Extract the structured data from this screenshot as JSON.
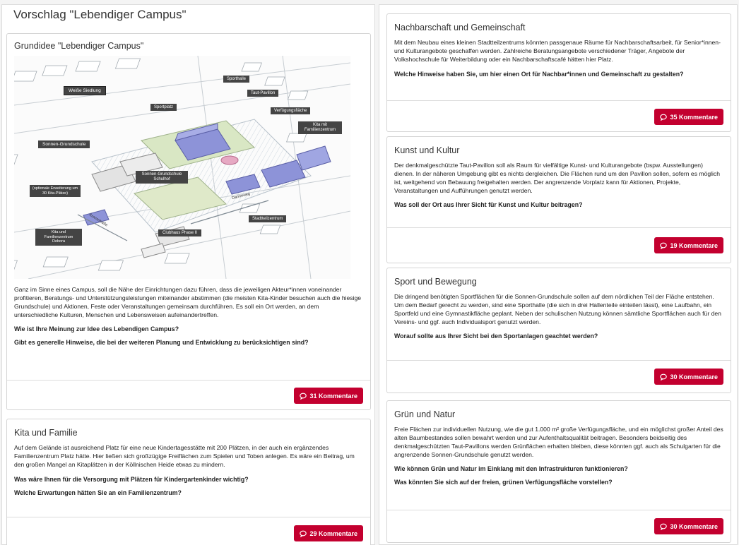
{
  "page": {
    "title": "Vorschlag \"Lebendiger Campus\""
  },
  "cards": [
    {
      "title": "Grundidee \"Lebendiger Campus\"",
      "text": "Ganz im Sinne eines Campus, soll die Nähe der Einrichtungen dazu führen, dass die jeweiligen Akteur*innen voneinander profitieren, Beratungs- und Unterstützungsleistungen miteinander abstimmen (die meisten Kita-Kinder besuchen auch die hiesige Grundschule) und Aktionen, Feste oder Veranstaltungen gemeinsam durchführen. Es soll ein Ort werden, an dem unterschiedliche Kulturen, Menschen und Lebensweisen aufeinandertreffen.",
      "questions": [
        "Wie ist Ihre Meinung zur Idee des Lebendigen Campus?",
        "Gibt es generelle Hinweise, die bei der weiteren Planung und Entwicklung zu berücksichtigen sind?"
      ],
      "button": "31 Kommentare"
    },
    {
      "title": "Kita und Familie",
      "text": "Auf dem Gelände ist ausreichend Platz für eine neue Kindertagesstätte mit 200 Plätzen, in der auch ein ergänzendes Familienzentrum Platz hätte. Hier ließen sich großzügige Freiflächen zum Spielen und Toben anlegen. Es wäre ein Beitrag, um den großen Mangel an Kitaplätzen in der Köllnischen Heide etwas zu mindern.",
      "questions": [
        "Was wäre Ihnen für die Versorgung mit Plätzen für Kindergartenkinder wichtig?",
        "Welche Erwartungen hätten Sie an ein Familienzentrum?"
      ],
      "button": "29 Kommentare"
    },
    {
      "title": "Nachbarschaft und Gemeinschaft",
      "text": "Mit dem Neubau eines kleinen Stadtteilzentrums könnten passgenaue Räume für Nachbarschaftsarbeit, für Senior*innen- und Kulturangebote geschaffen werden. Zahlreiche Beratungsangebote verschiedener Träger, Angebote der Volkshochschule für Weiterbildung oder ein Nachbarschaftscafé hätten hier Platz.",
      "questions": [
        "Welche Hinweise haben Sie, um hier einen Ort für Nachbar*innen und Gemeinschaft zu gestalten?"
      ],
      "button": "35 Kommentare"
    },
    {
      "title": "Kunst und Kultur",
      "text": "Der denkmalgeschützte Taut-Pavillon soll als Raum für vielfältige Kunst- und Kulturangebote (bspw. Ausstellungen) dienen. In der näheren Umgebung gibt es nichts dergleichen. Die Flächen rund um den Pavillon sollen, sofern es möglich ist, weitgehend von Bebauung freigehalten werden. Der angrenzende Vorplatz kann für Aktionen, Projekte, Veranstaltungen und Aufführungen genutzt werden.",
      "questions": [
        "Was soll der Ort aus Ihrer Sicht für Kunst und Kultur beitragen?"
      ],
      "button": "19 Kommentare"
    },
    {
      "title": "Sport und Bewegung",
      "text": "Die dringend benötigten Sportflächen für die Sonnen-Grundschule sollen auf dem nördlichen Teil der Fläche entstehen. Um dem Bedarf gerecht zu werden, sind eine Sporthalle (die sich in drei Hallenteile einteilen lässt), eine Laufbahn, ein Sportfeld und eine Gymnastikfläche geplant. Neben der schulischen Nutzung können sämtliche Sportflächen auch für den Vereins- und ggf. auch Individualsport genutzt werden.",
      "questions": [
        "Worauf sollte aus Ihrer Sicht bei den Sportanlagen geachtet werden?"
      ],
      "button": "30 Kommentare"
    },
    {
      "title": "Grün und Natur",
      "text": "Freie Flächen zur individuellen Nutzung, wie die gut 1.000 m² große Verfügungsfläche, und ein möglichst großer Anteil des alten Baumbestandes sollen bewahrt werden und zur Aufenthaltsqualität beitragen. Besonders beidseitig des denkmalgeschützten Taut-Pavillons werden Grünflächen erhalten bleiben, diese könnten ggf. auch als Schulgarten für die angrenzende Sonnen-Grundschule genutzt werden.",
      "questions": [
        "Wie können Grün und Natur im Einklang mit den Infrastrukturen funktionieren?",
        "Was könnten Sie sich auf der freien, grünen Verfügungsfläche vorstellen?"
      ],
      "button": "30 Kommentare"
    }
  ],
  "map_labels": {
    "weisse_siedlung": "Weiße Siedlung",
    "sporthalle": "Sporthalle",
    "taut_pavillon": "Taut-Pavillon",
    "sportplatz": "Sportplatz",
    "verfuegungsflaeche": "Verfügungsfläche",
    "kita_familienzentrum": "Kita mit Familienzentrum",
    "sonnen_grundschule": "Sonnen-Grundschule",
    "schulhof": "Sonnen-Grundschule Schulhof",
    "erweiterung": "(optionale Erweiterung um 30 Kita-Plätze)",
    "stadtteilzentrum": "Stadtteilzentrum",
    "kita_debora": "Kita und Familienzentrum Debora",
    "clubhaus": "Clubhaus Phase II",
    "dammweg": "Dammweg",
    "aronsstrasse": "Aronsstraße"
  },
  "colors": {
    "accent": "#c3002f"
  },
  "icons": {
    "comment": "comment-icon"
  }
}
